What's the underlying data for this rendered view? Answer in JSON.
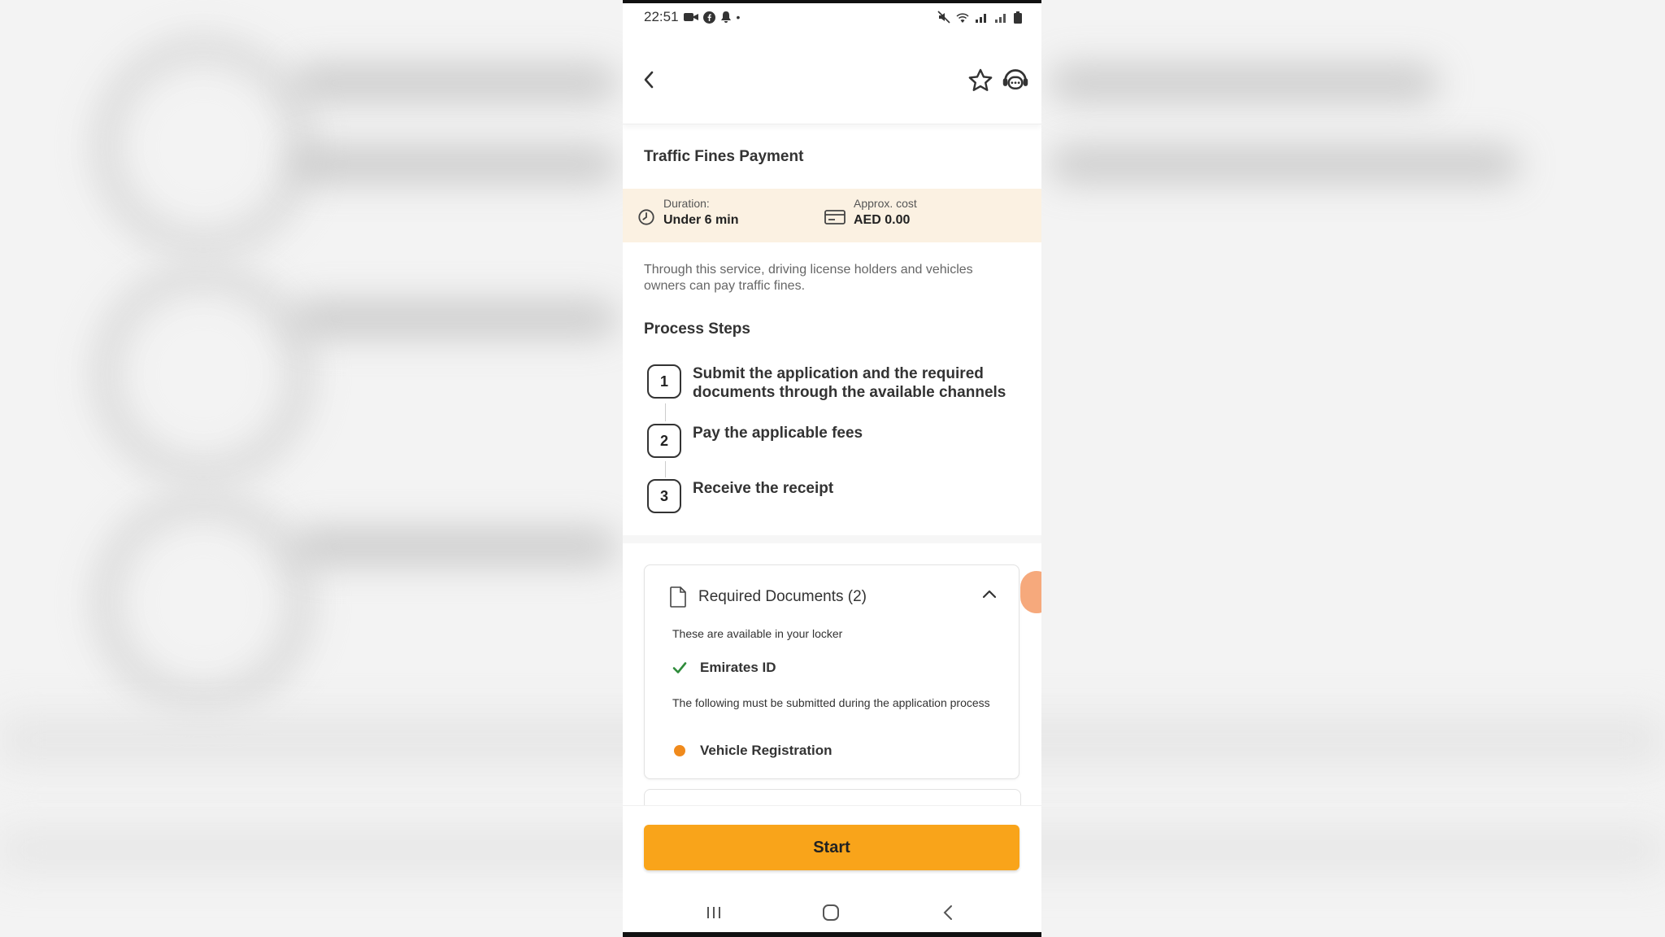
{
  "status_bar": {
    "time": "22:51"
  },
  "page": {
    "title": "Traffic Fines Payment"
  },
  "info": {
    "duration_label": "Duration:",
    "duration_value": "Under 6 min",
    "cost_label": "Approx. cost",
    "cost_value": "AED 0.00"
  },
  "description": "Through this service, driving license holders and vehicles owners can pay traffic fines.",
  "process": {
    "title": "Process Steps",
    "steps": [
      {
        "num": "1",
        "text": "Submit the application and the required documents through the available channels"
      },
      {
        "num": "2",
        "text": "Pay the applicable fees"
      },
      {
        "num": "3",
        "text": "Receive the receipt"
      }
    ]
  },
  "documents": {
    "title": "Required Documents (2)",
    "locker_note": "These are available in your locker",
    "locker_items": [
      "Emirates ID"
    ],
    "submit_note": "The following must be submitted during the application process",
    "submit_items": [
      "Vehicle Registration"
    ]
  },
  "actions": {
    "start_label": "Start"
  },
  "colors": {
    "accent": "#f9a41a",
    "info_bg": "#fbf1e2",
    "check": "#2e8b3a",
    "pending_dot": "#f08a1c"
  },
  "icons": [
    "back-arrow-icon",
    "star-icon",
    "chat-icon",
    "clock-icon",
    "card-icon",
    "document-icon",
    "chevron-up-icon",
    "check-icon"
  ]
}
